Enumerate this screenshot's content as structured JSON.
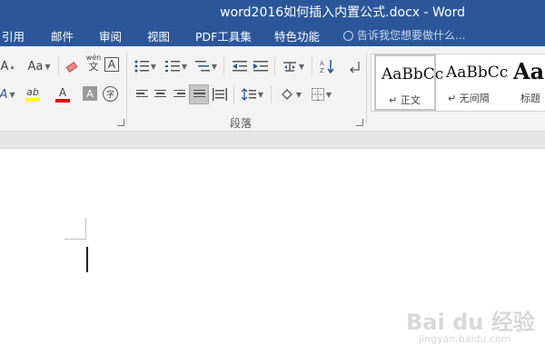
{
  "window": {
    "title": "word2016如何插入内置公式.docx - Word"
  },
  "menu": {
    "tabs": [
      "引用",
      "邮件",
      "审阅",
      "视图",
      "PDF工具集",
      "特色功能"
    ],
    "search_placeholder": "告诉我您想要做什么..."
  },
  "ribbon": {
    "font": {
      "grow_label": "A",
      "case_label": "Aa",
      "pinyin_top": "wén",
      "pinyin_bottom": "文",
      "border_char_label": "A",
      "highlight_label": "ab",
      "font_color_label": "A",
      "shading_label": "A",
      "circle_char_label": "字"
    },
    "paragraph": {
      "group_label": "段落"
    },
    "styles": [
      {
        "preview": "AaBbCc",
        "name": "正文"
      },
      {
        "preview": "AaBbCc",
        "name": "无间隔"
      },
      {
        "preview": "AaB",
        "name": "标题"
      }
    ]
  },
  "watermark": {
    "logo": "Bai du 经验",
    "url": "jingyan.baidu.com"
  }
}
